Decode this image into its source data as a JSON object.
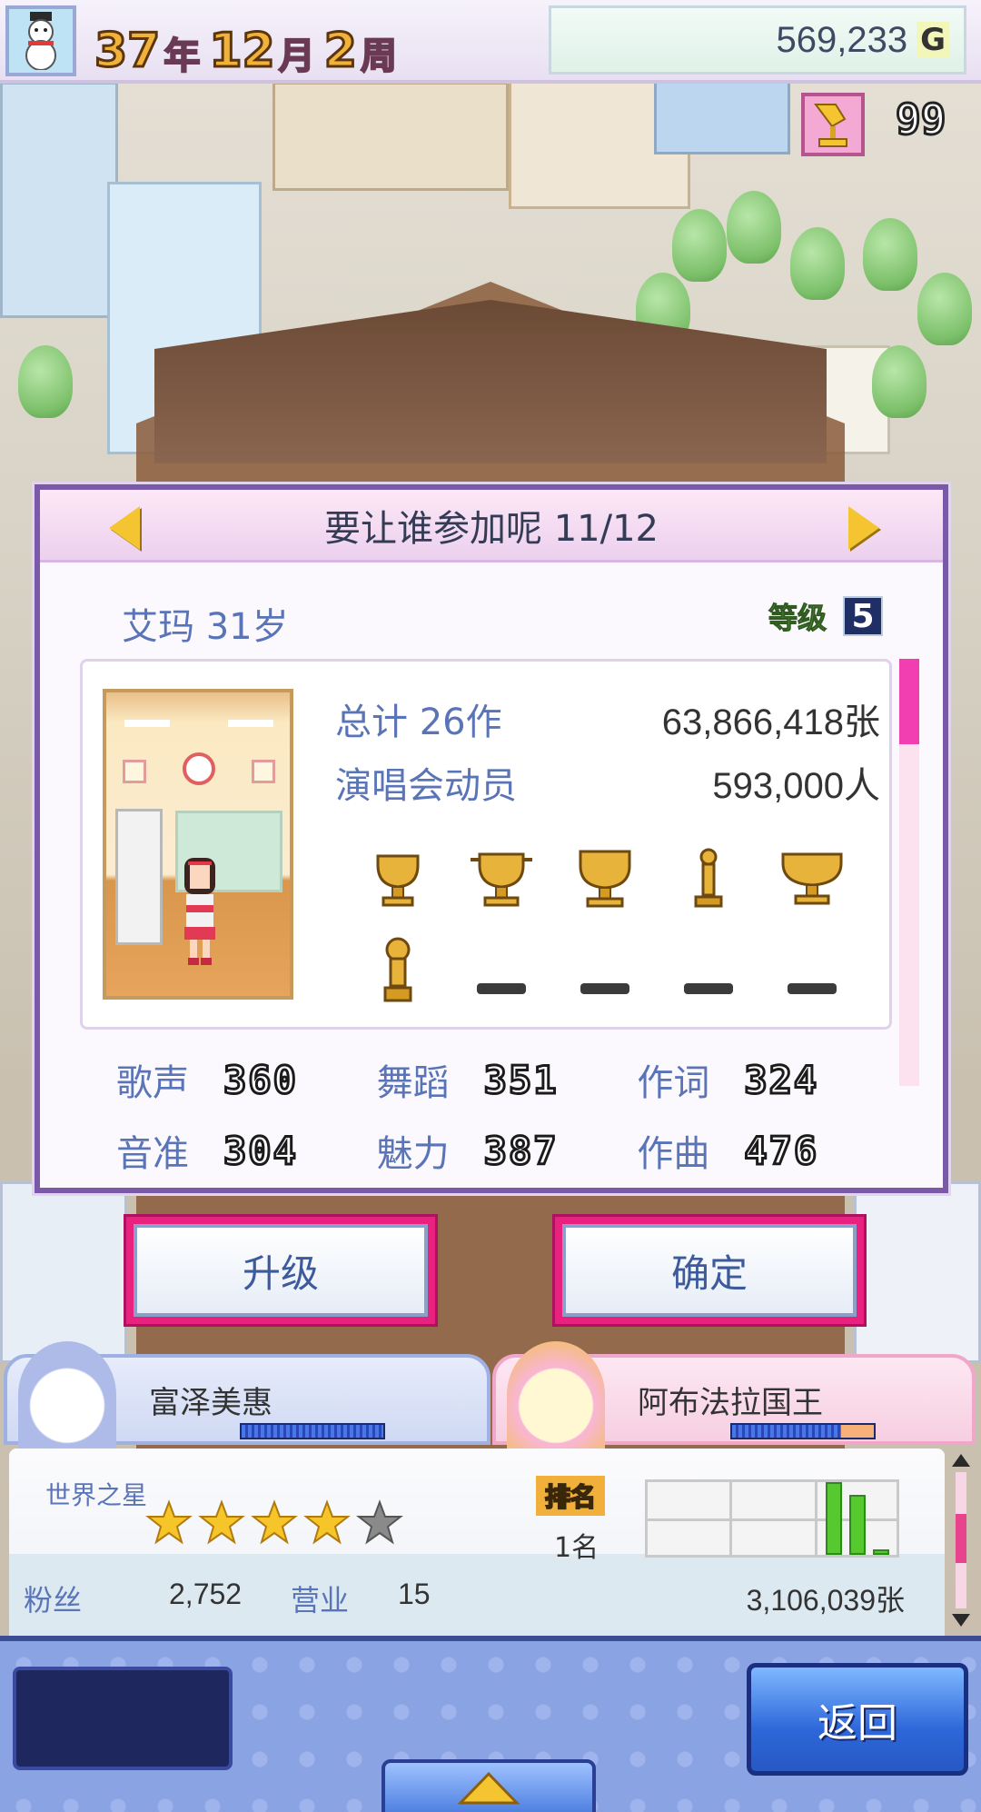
{
  "hud": {
    "year_num": "37",
    "year_unit": "年",
    "month_num": "12",
    "month_unit": "月",
    "week_num": "2",
    "week_unit": "周",
    "money": "569,233",
    "currency": "G",
    "trophy_count": "99"
  },
  "dialog": {
    "title": "要让谁参加呢 11/12",
    "name_age": "艾玛 31岁",
    "level_label": "等级",
    "level_value": "5",
    "total_label": "总计 26作",
    "total_value": "63,866,418张",
    "concert_label": "演唱会动员",
    "concert_value": "593,000人",
    "trophies": [
      "gold-cup",
      "gold-cup",
      "gold-cup",
      "gold-statue",
      "gold-cup",
      "gold-statue",
      "empty",
      "empty",
      "empty",
      "empty"
    ],
    "attributes": [
      {
        "label": "歌声",
        "value": "360"
      },
      {
        "label": "舞蹈",
        "value": "351"
      },
      {
        "label": "作词",
        "value": "324"
      },
      {
        "label": "音准",
        "value": "304"
      },
      {
        "label": "魅力",
        "value": "387"
      },
      {
        "label": "作曲",
        "value": "476"
      }
    ]
  },
  "buttons": {
    "upgrade": "升级",
    "confirm": "确定",
    "back": "返回"
  },
  "staff": {
    "left_name": "富泽美惠",
    "right_name": "阿布法拉国王"
  },
  "info": {
    "title": "世界之星",
    "stars_filled": 4,
    "stars_total": 5,
    "rank_label": "排名",
    "rank_value": "1名",
    "fans_label": "粉丝",
    "fans_value": "2,752",
    "business_label": "营业",
    "business_value": "15",
    "sales_value": "3,106,039张"
  },
  "colors": {
    "accent_pink": "#e8227e",
    "label_blue": "#5a74b8",
    "dialog_border": "#7a5aa8",
    "gold": "#f4c431"
  }
}
